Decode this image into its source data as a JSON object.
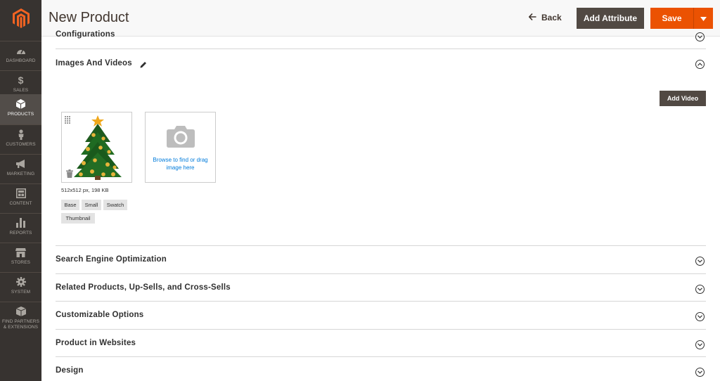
{
  "sidebar": {
    "items": [
      {
        "label": "DASHBOARD",
        "icon": "speedometer-icon"
      },
      {
        "label": "SALES",
        "icon": "dollar-icon"
      },
      {
        "label": "PRODUCTS",
        "icon": "cube-icon"
      },
      {
        "label": "CUSTOMERS",
        "icon": "person-icon"
      },
      {
        "label": "MARKETING",
        "icon": "megaphone-icon"
      },
      {
        "label": "CONTENT",
        "icon": "layout-icon"
      },
      {
        "label": "REPORTS",
        "icon": "bar-chart-icon"
      },
      {
        "label": "STORES",
        "icon": "storefront-icon"
      },
      {
        "label": "SYSTEM",
        "icon": "gear-icon"
      },
      {
        "label": "FIND PARTNERS & EXTENSIONS",
        "icon": "box-icon"
      }
    ],
    "active": "PRODUCTS"
  },
  "header": {
    "title": "New Product",
    "back_label": "Back",
    "add_attribute_label": "Add Attribute",
    "save_label": "Save"
  },
  "sections": {
    "configurations": "Configurations",
    "images_and_videos": "Images And Videos",
    "seo": "Search Engine Optimization",
    "related": "Related Products, Up-Sells, and Cross-Sells",
    "customizable": "Customizable Options",
    "websites": "Product in Websites",
    "design": "Design"
  },
  "images": {
    "add_video_label": "Add Video",
    "upload_text": "Browse to find or drag image here",
    "meta": "512x512 px, 198 KB",
    "roles": [
      "Base",
      "Small",
      "Swatch",
      "Thumbnail"
    ]
  },
  "colors": {
    "sidebar_bg": "#373330",
    "primary_orange": "#eb5202",
    "dark_button": "#514943",
    "link_blue": "#007bdb"
  }
}
